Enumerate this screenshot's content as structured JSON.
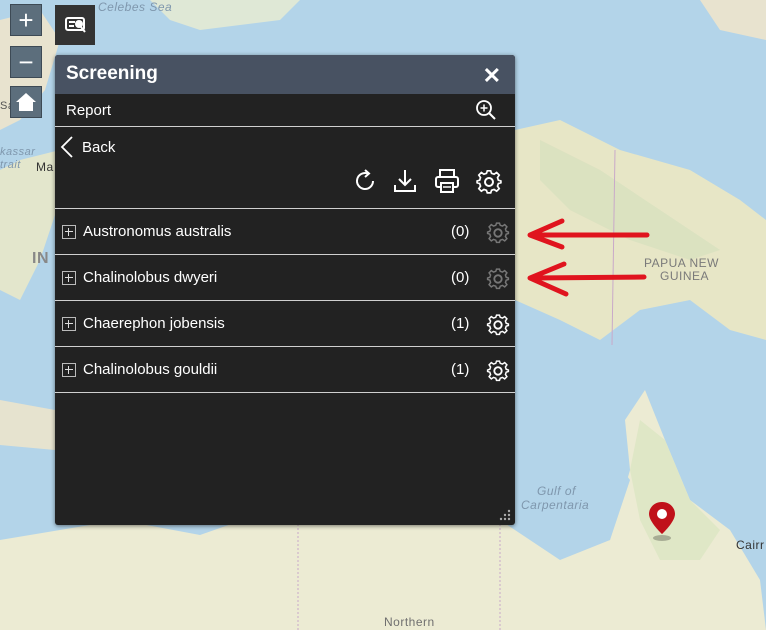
{
  "map": {
    "labels": {
      "celebes_sea": "Celebes Sea",
      "makassar_strait_1": "kassar",
      "makassar_strait_2": "trait",
      "ma": "Ma",
      "in": "IN",
      "san": "San",
      "papua_1": "PAPUA NEW",
      "papua_2": "GUINEA",
      "gulf_1": "Gulf of",
      "gulf_2": "Carpentaria",
      "cairns": "Cairr",
      "northern": "Northern"
    }
  },
  "controls": {
    "zoom_in": "+",
    "zoom_out": "−",
    "home_icon": "home-icon",
    "widget_icon": "screening-widget-icon"
  },
  "panel": {
    "title": "Screening",
    "close": "✕",
    "report_label": "Report",
    "back_label": "Back",
    "toolbar_icons": [
      "refresh-icon",
      "download-icon",
      "print-icon",
      "settings-icon"
    ],
    "rows": [
      {
        "name": "Austronomus australis",
        "count": "(0)",
        "gear_enabled": false
      },
      {
        "name": "Chalinolobus dwyeri",
        "count": "(0)",
        "gear_enabled": false
      },
      {
        "name": "Chaerephon jobensis",
        "count": "(1)",
        "gear_enabled": true
      },
      {
        "name": "Chalinolobus gouldii",
        "count": "(1)",
        "gear_enabled": true
      }
    ]
  },
  "colors": {
    "panel_bg": "#222222",
    "header_bg": "#485262",
    "annotation_arrow": "#e0141e",
    "pin": "#c0111a"
  }
}
